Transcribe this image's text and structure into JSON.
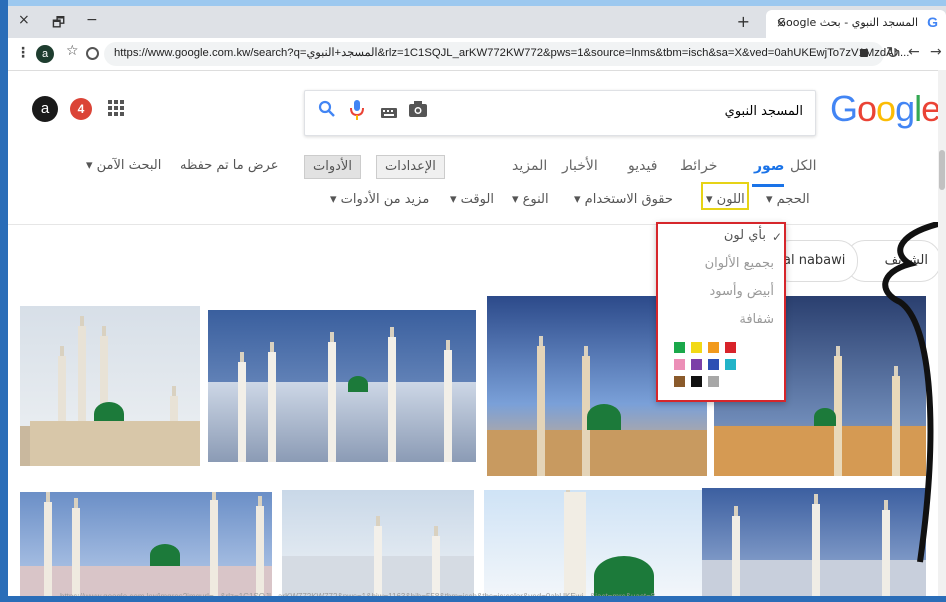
{
  "browser": {
    "tab_title": "المسجد النبوي - بحث Google",
    "url": "https://www.google.com.kw/search?q=المسجد+النبوي&rlz=1C1SQJL_arKW772KW772&pws=1&source=lnms&tbm=isch&sa=X&ved=0ahUKEwjTo7zV1MzdAh...",
    "profile_initial": "a",
    "win_close": "×",
    "win_restore": "🗗",
    "win_minimize": "−",
    "new_tab": "+",
    "tab_close": "×"
  },
  "google": {
    "logo_letters": [
      "G",
      "o",
      "o",
      "g",
      "l",
      "e"
    ],
    "logo_colors": [
      "#4285f4",
      "#ea4335",
      "#fbbc05",
      "#4285f4",
      "#34a853",
      "#ea4335"
    ],
    "search_value": "المسجد النبوي",
    "account_initial": "a",
    "notification_count": "4"
  },
  "nav_tabs": [
    {
      "label": "الكل"
    },
    {
      "label": "صور"
    },
    {
      "label": "خرائط"
    },
    {
      "label": "فيديو"
    },
    {
      "label": "الأخبار"
    },
    {
      "label": "المزيد"
    }
  ],
  "nav_buttons": {
    "settings": "الإعدادات",
    "tools": "الأدوات"
  },
  "nav_right": {
    "safe_search": "البحث الآمن ▾",
    "saved": "عرض ما تم حفظه"
  },
  "tools": [
    {
      "label": "الحجم ▾"
    },
    {
      "label": "اللون ▾"
    },
    {
      "label": "حقوق الاستخدام ▾"
    },
    {
      "label": "النوع ▾"
    },
    {
      "label": "الوقت ▾"
    },
    {
      "label": "مزيد من الأدوات ▾"
    }
  ],
  "chips": [
    {
      "label": "الشريف"
    },
    {
      "label": "al nabawi"
    }
  ],
  "color_menu": {
    "check": "✓",
    "items": [
      {
        "label": "بأي لون"
      },
      {
        "label": "بجميع الألوان"
      },
      {
        "label": "أبيض وأسود"
      },
      {
        "label": "شفافة"
      }
    ],
    "swatches": [
      "#1aa84a",
      "#f2d916",
      "#f29a1c",
      "#d8232a",
      "#ec8fb7",
      "#7b3fa8",
      "#2d4fb4",
      "#22b4c8",
      "#8a5a2b",
      "#111111",
      "#a7a7a7"
    ]
  },
  "status_url": "https://www.google.com.kw/imgres?imgurl=...&rlz=1C1SQJL_arKW772KW772&pws=1&biw=1163&bih=558&tbm=isch&tbs=ic:color&ved=0ahUKEwj...&iact=mrc&uact=8"
}
